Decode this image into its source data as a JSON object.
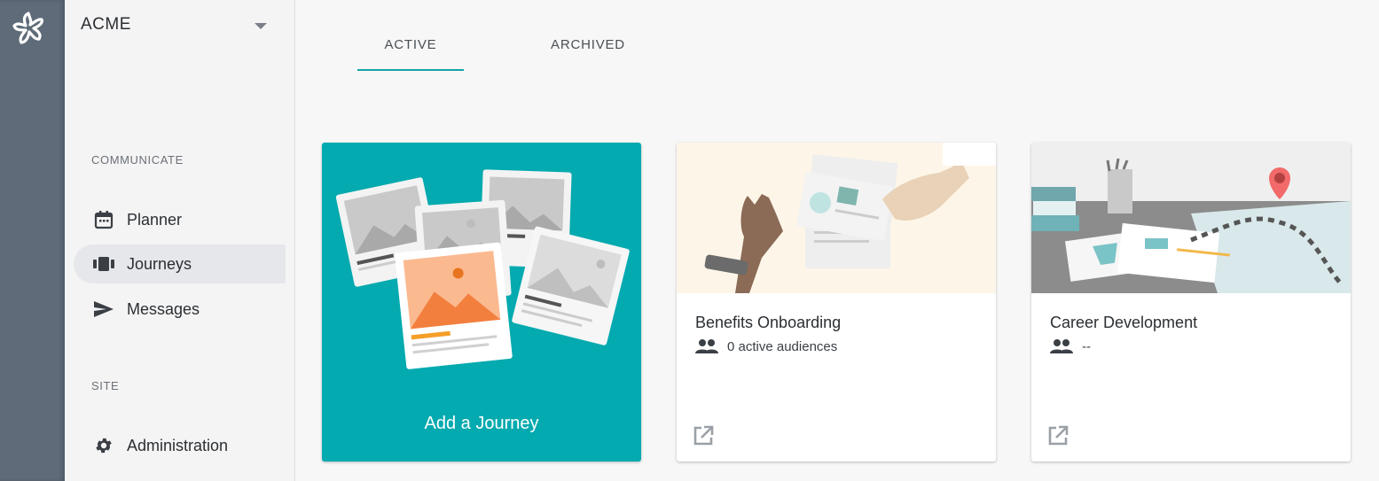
{
  "org": {
    "name": "ACME"
  },
  "sidebar": {
    "sections": [
      {
        "label": "COMMUNICATE"
      },
      {
        "label": "SITE"
      }
    ],
    "items": [
      {
        "label": "Planner",
        "icon": "calendar-icon"
      },
      {
        "label": "Journeys",
        "icon": "journeys-icon",
        "active": true
      },
      {
        "label": "Messages",
        "icon": "send-icon"
      },
      {
        "label": "Administration",
        "icon": "gear-icon"
      }
    ]
  },
  "tabs": [
    {
      "label": "ACTIVE",
      "selected": true
    },
    {
      "label": "ARCHIVED",
      "selected": false
    }
  ],
  "cards": {
    "add": {
      "label": "Add a Journey"
    },
    "journeys": [
      {
        "title": "Benefits Onboarding",
        "audiences": "0 active audiences"
      },
      {
        "title": "Career Development",
        "audiences": "--"
      }
    ]
  },
  "colors": {
    "accent": "#03aaaf",
    "rail": "#5f6b78",
    "tab_underline": "#16a3a6"
  }
}
